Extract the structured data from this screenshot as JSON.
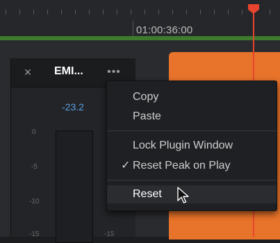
{
  "timeline": {
    "timecode": "01:00:36:00"
  },
  "plugin": {
    "close_glyph": "×",
    "title": "EMI...",
    "more_glyph": "•••",
    "peak_value": "-23.2",
    "scale_left": [
      "0",
      "-5",
      "-10",
      "-15"
    ],
    "scale_right": [
      "-15"
    ]
  },
  "menu": {
    "items": [
      {
        "label": "Copy"
      },
      {
        "label": "Paste"
      },
      {
        "label": "Lock Plugin Window"
      },
      {
        "label": "Reset Peak on Play",
        "checked": true
      },
      {
        "label": "Reset"
      }
    ],
    "check_glyph": "✓"
  },
  "colors": {
    "playhead": "#e8442f",
    "clip": "#e8732a",
    "track": "#3f7a2e",
    "peak_value": "#5aa0e8"
  }
}
